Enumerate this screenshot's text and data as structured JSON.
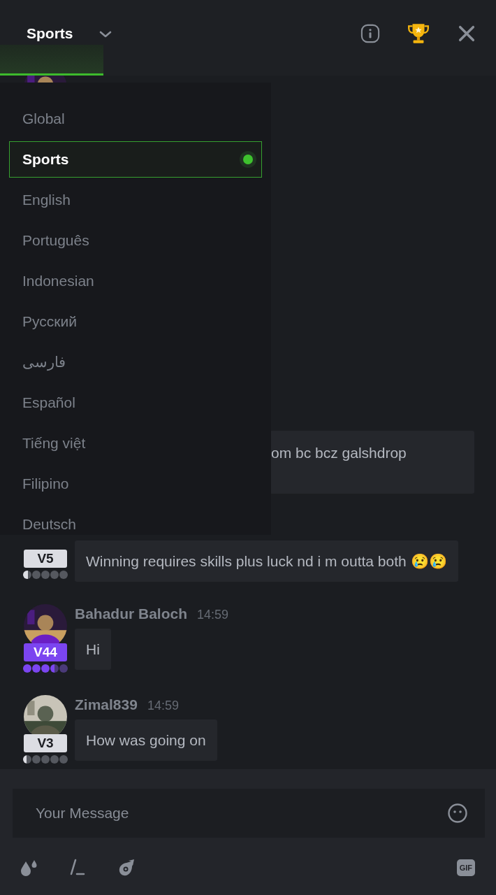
{
  "header": {
    "title": "Sports"
  },
  "channels": [
    {
      "label": "Global",
      "selected": false
    },
    {
      "label": "Sports",
      "selected": true
    },
    {
      "label": "English",
      "selected": false
    },
    {
      "label": "Português",
      "selected": false
    },
    {
      "label": "Indonesian",
      "selected": false
    },
    {
      "label": "Русский",
      "selected": false
    },
    {
      "label": "فارسی",
      "selected": false
    },
    {
      "label": "Español",
      "selected": false
    },
    {
      "label": "Tiếng việt",
      "selected": false
    },
    {
      "label": "Filipino",
      "selected": false
    },
    {
      "label": "Deutsch",
      "selected": false
    }
  ],
  "messages": [
    {
      "avatar": {
        "kind": "picture"
      }
    },
    {
      "text": "om bc bcz galshdrop"
    },
    {
      "badge": {
        "label": "V5",
        "color": "#dcdde3"
      },
      "stars": 0.6,
      "text": "Winning requires skills plus luck nd i m outta both 😢😢"
    },
    {
      "user": "Bahadur Baloch",
      "time": "14:59",
      "avatar": {
        "kind": "picture"
      },
      "badge": {
        "label": "V44",
        "color": "#7b45f0"
      },
      "stars": 3.5,
      "text": "Hi"
    },
    {
      "user": "Zimal839",
      "time": "14:59",
      "avatar": {
        "kind": "picture"
      },
      "badge": {
        "label": "V3",
        "color": "#dcdde3"
      },
      "stars": 0.4,
      "text": "How was going on"
    }
  ],
  "composer": {
    "placeholder": "Your Message",
    "gif_button": "GIF"
  }
}
